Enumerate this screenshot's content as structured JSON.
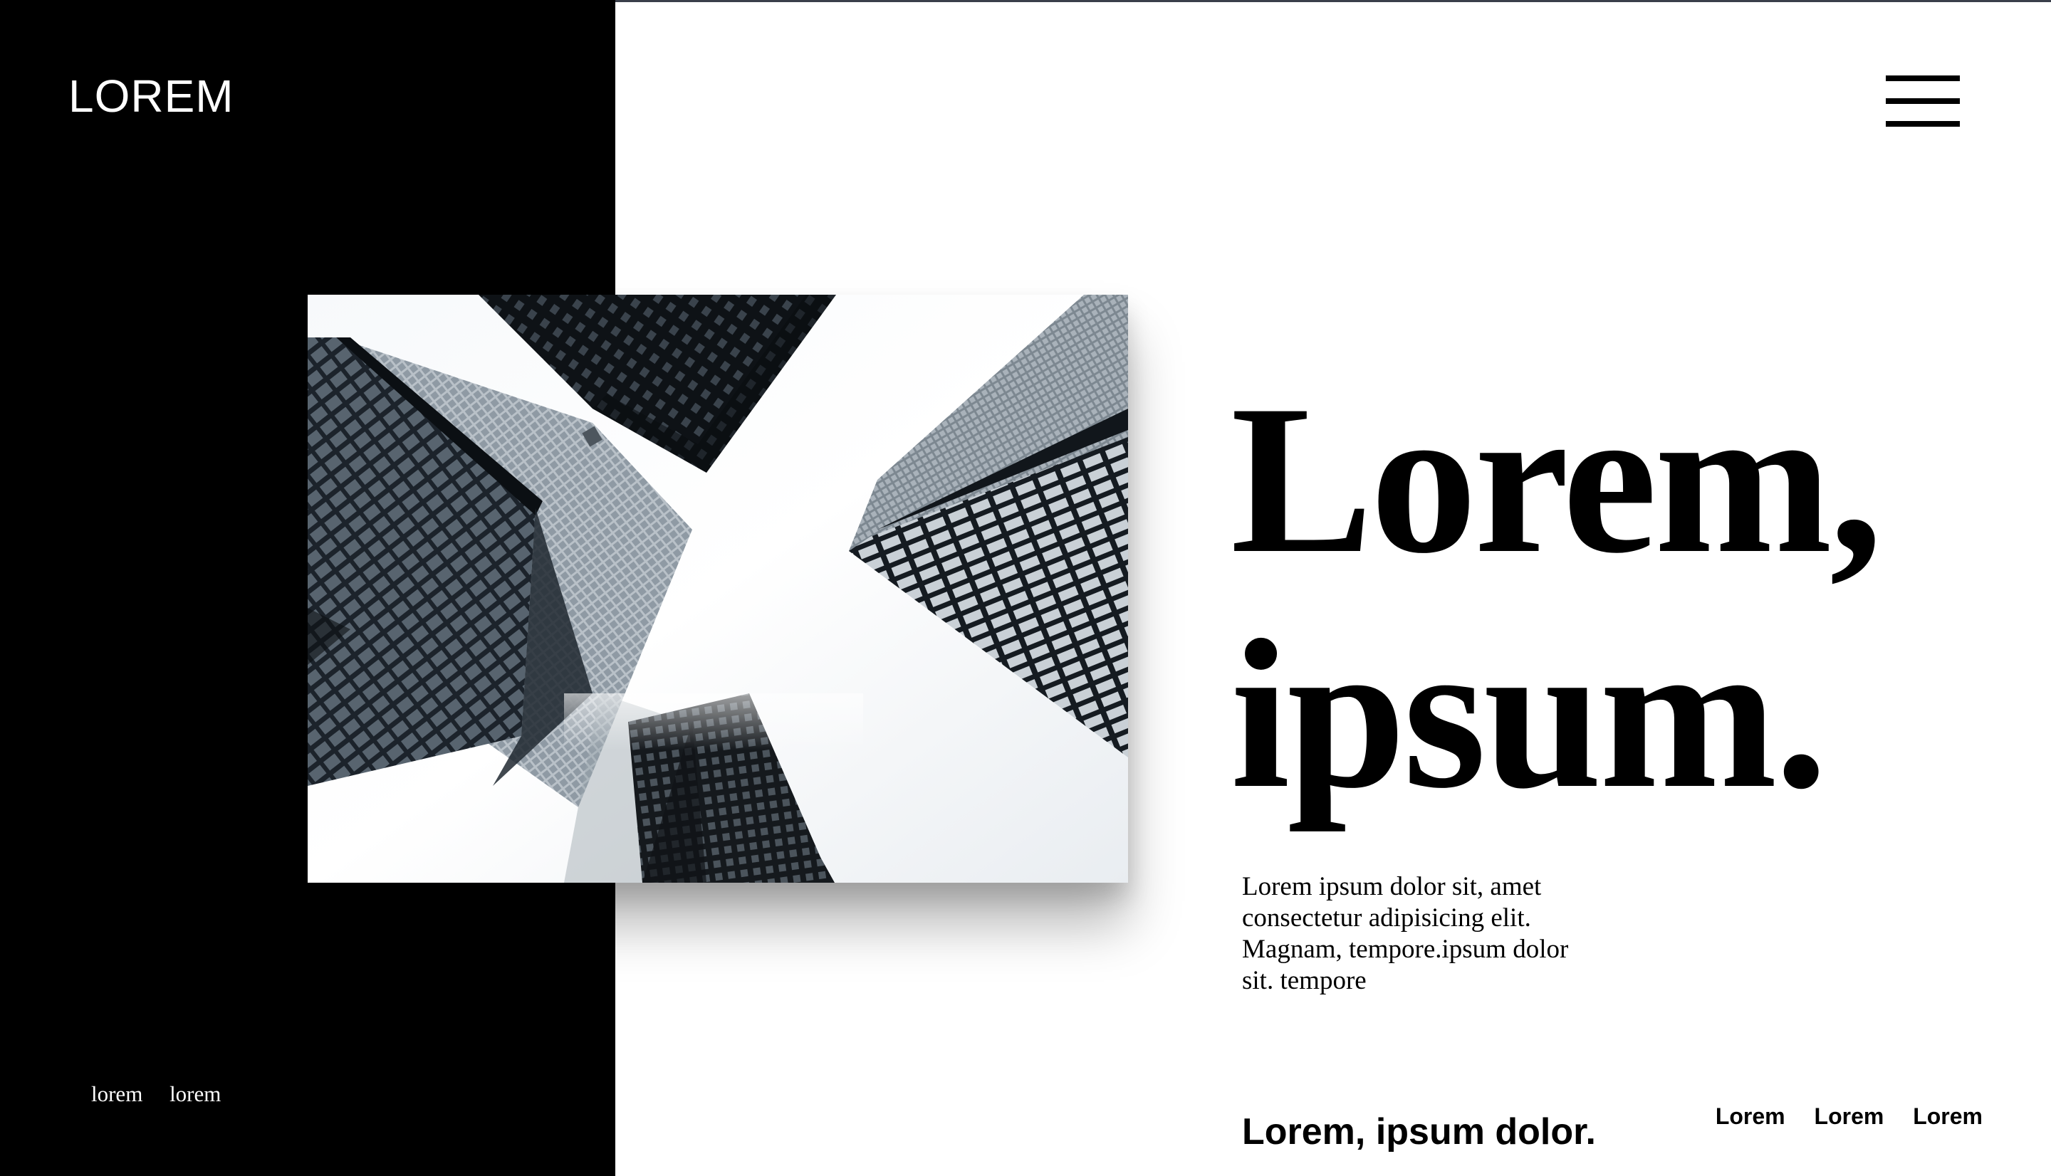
{
  "brand": {
    "logo": "LOREM"
  },
  "header": {
    "menu_icon": "hamburger-menu-icon"
  },
  "hero": {
    "image_alt": "Looking up at skyscrapers",
    "headline_line1": "Lorem,",
    "headline_line2": "ipsum.",
    "body_line1": "Lorem ipsum dolor sit, amet",
    "body_line2": "consectetur adipisicing elit.",
    "body_line3": "Magnam, tempore.ipsum dolor",
    "body_line4": "sit. tempore"
  },
  "footer": {
    "left_links": [
      "lorem",
      "lorem"
    ],
    "tagline": "Lorem, ipsum dolor.",
    "right_links": [
      "Lorem",
      "Lorem",
      "Lorem"
    ]
  },
  "colors": {
    "panel": "#000000",
    "background": "#ffffff",
    "text": "#000000"
  }
}
